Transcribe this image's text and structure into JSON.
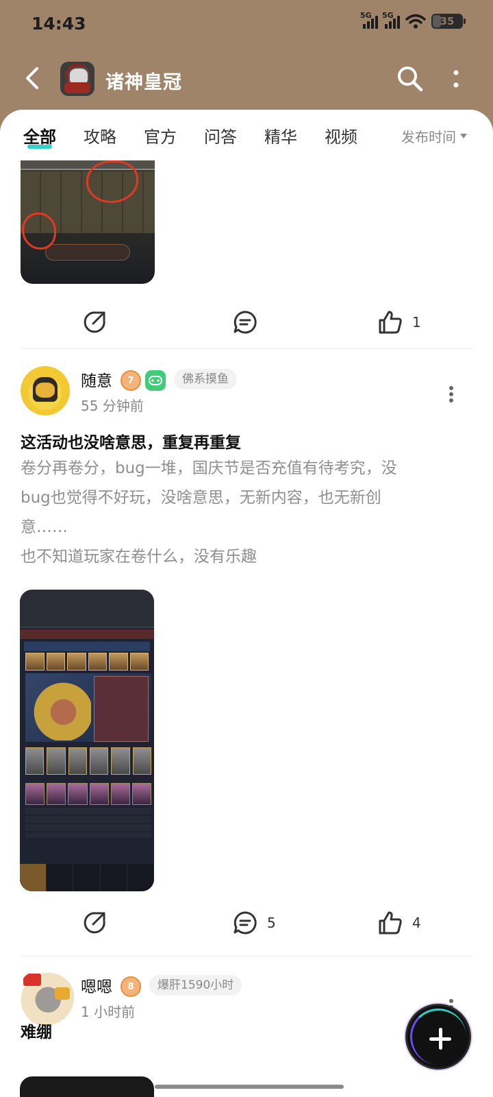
{
  "status_bar": {
    "time": "14:43",
    "network_1": "5G",
    "network_2": "5G",
    "battery": "35"
  },
  "header": {
    "title": "诸神皇冠",
    "back_icon": "back-arrow-icon",
    "search_icon": "search-icon",
    "more_icon": "more-vertical-icon"
  },
  "tabs": {
    "items": [
      {
        "label": "全部",
        "active": true
      },
      {
        "label": "攻略",
        "active": false
      },
      {
        "label": "官方",
        "active": false
      },
      {
        "label": "问答",
        "active": false
      },
      {
        "label": "精华",
        "active": false
      },
      {
        "label": "视频",
        "active": false
      }
    ],
    "sort_label": "发布时间"
  },
  "posts": [
    {
      "likes": "1",
      "comments": "",
      "share_icon": "share-icon",
      "comment_icon": "comment-icon",
      "like_icon": "thumbs-up-icon"
    },
    {
      "username": "随意",
      "level": "7",
      "tag": "佛系摸鱼",
      "time": "55 分钟前",
      "title": "这活动也没啥意思，重复再重复",
      "body_lines": [
        "卷分再卷分，bug一堆，国庆节是否充值有待考究，没",
        "bug也觉得不好玩，没啥意思，无新内容，也无新创",
        "意……",
        "也不知道玩家在卷什么，没有乐趣"
      ],
      "comments": "5",
      "likes": "4"
    },
    {
      "username": "嗯嗯",
      "level": "8",
      "tag": "爆肝1590小时",
      "time": "1 小时前",
      "title": "难绷"
    }
  ],
  "fab_icon": "plus-icon",
  "colors": {
    "header_bg": "#a0846a",
    "accent": "#33d3c8"
  }
}
